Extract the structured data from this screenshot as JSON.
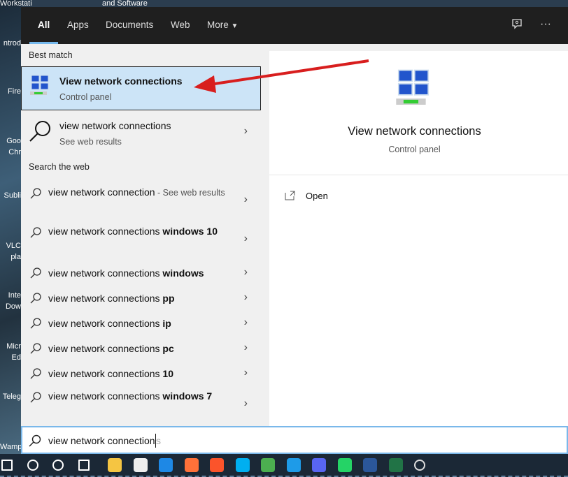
{
  "desktop": {
    "top_texts": [
      "Workstati",
      "and Software"
    ],
    "icons": [
      "ntrod",
      "Fire",
      "Goo",
      "Chr",
      "Subli",
      "VLC",
      "pla",
      "Inte",
      "Dow",
      "Micr",
      "Ed",
      "Teleg",
      "Wamp"
    ]
  },
  "tabs": [
    {
      "label": "All",
      "active": true
    },
    {
      "label": "Apps"
    },
    {
      "label": "Documents"
    },
    {
      "label": "Web"
    },
    {
      "label": "More"
    }
  ],
  "header_icons": [
    "feedback-icon",
    "more-options-icon"
  ],
  "more_ellipsis": "···",
  "sections": {
    "best_match": "Best match",
    "search_web": "Search the web"
  },
  "best_match": {
    "title": "View network connections",
    "subtitle": "Control panel"
  },
  "web_result": {
    "title": "view network connections",
    "subtitle": "See web results"
  },
  "suggestions": [
    {
      "prefix": "view network connection",
      "bold": "",
      "suffix": " - See web results"
    },
    {
      "prefix": "view network connections",
      "bold": " windows 10",
      "suffix": ""
    },
    {
      "prefix": "view network connections",
      "bold": " windows",
      "suffix": ""
    },
    {
      "prefix": "view network connections",
      "bold": " pp",
      "suffix": ""
    },
    {
      "prefix": "view network connections",
      "bold": " ip",
      "suffix": ""
    },
    {
      "prefix": "view network connections",
      "bold": " pc",
      "suffix": ""
    },
    {
      "prefix": "view network connections",
      "bold": " 10",
      "suffix": ""
    },
    {
      "prefix": "view network connections",
      "bold": " windows 7",
      "suffix": ""
    }
  ],
  "preview": {
    "title": "View network connections",
    "subtitle": "Control panel",
    "actions": [
      {
        "label": "Open",
        "icon": "open-icon"
      }
    ]
  },
  "search": {
    "typed": "view network connection",
    "autocomplete": "s"
  },
  "taskbar": [
    "windows-start",
    "search",
    "cortana",
    "task-view",
    "file-explorer",
    "store",
    "mail",
    "firefox",
    "brave",
    "skype",
    "chrome",
    "edge",
    "discord",
    "whatsapp",
    "word",
    "excel",
    "settings"
  ],
  "colors": {
    "accent": "#76b9ed",
    "selected": "#cce4f7",
    "annotation_arrow": "#d81e1e"
  }
}
